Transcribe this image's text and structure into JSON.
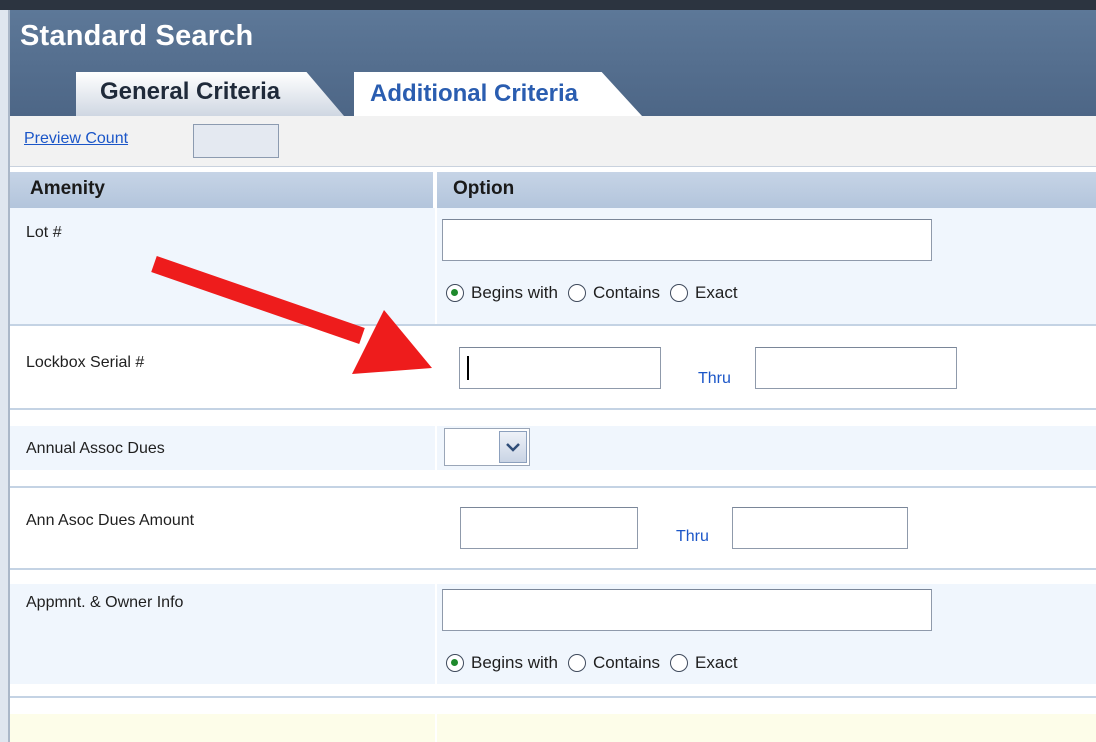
{
  "header": {
    "title": "Standard Search",
    "tabs": [
      {
        "label": "General Criteria",
        "active": false
      },
      {
        "label": "Additional Criteria",
        "active": true
      }
    ]
  },
  "preview": {
    "link_label": "Preview Count",
    "count_value": ""
  },
  "table": {
    "columns": [
      "Amenity",
      "Option"
    ],
    "rows": [
      {
        "label": "Lot #",
        "value": "",
        "radios": [
          {
            "label": "Begins with",
            "checked": true
          },
          {
            "label": "Contains",
            "checked": false
          },
          {
            "label": "Exact",
            "checked": false
          }
        ]
      },
      {
        "label": "Lockbox Serial #",
        "from_value": "",
        "thru_label": "Thru",
        "to_value": ""
      },
      {
        "label": "Annual Assoc Dues",
        "selected": ""
      },
      {
        "label": "Ann Asoc Dues Amount",
        "from_value": "",
        "thru_label": "Thru",
        "to_value": ""
      },
      {
        "label": "Appmnt. & Owner Info",
        "value": "",
        "radios": [
          {
            "label": "Begins with",
            "checked": true
          },
          {
            "label": "Contains",
            "checked": false
          },
          {
            "label": "Exact",
            "checked": false
          }
        ]
      }
    ]
  },
  "colors": {
    "header_bg": "#5a7595",
    "link_blue": "#1b56c8",
    "annotation_arrow": "#ee1c1c",
    "row_alt_bg": "#f0f6fd",
    "footer_bg": "#fdfde9"
  }
}
